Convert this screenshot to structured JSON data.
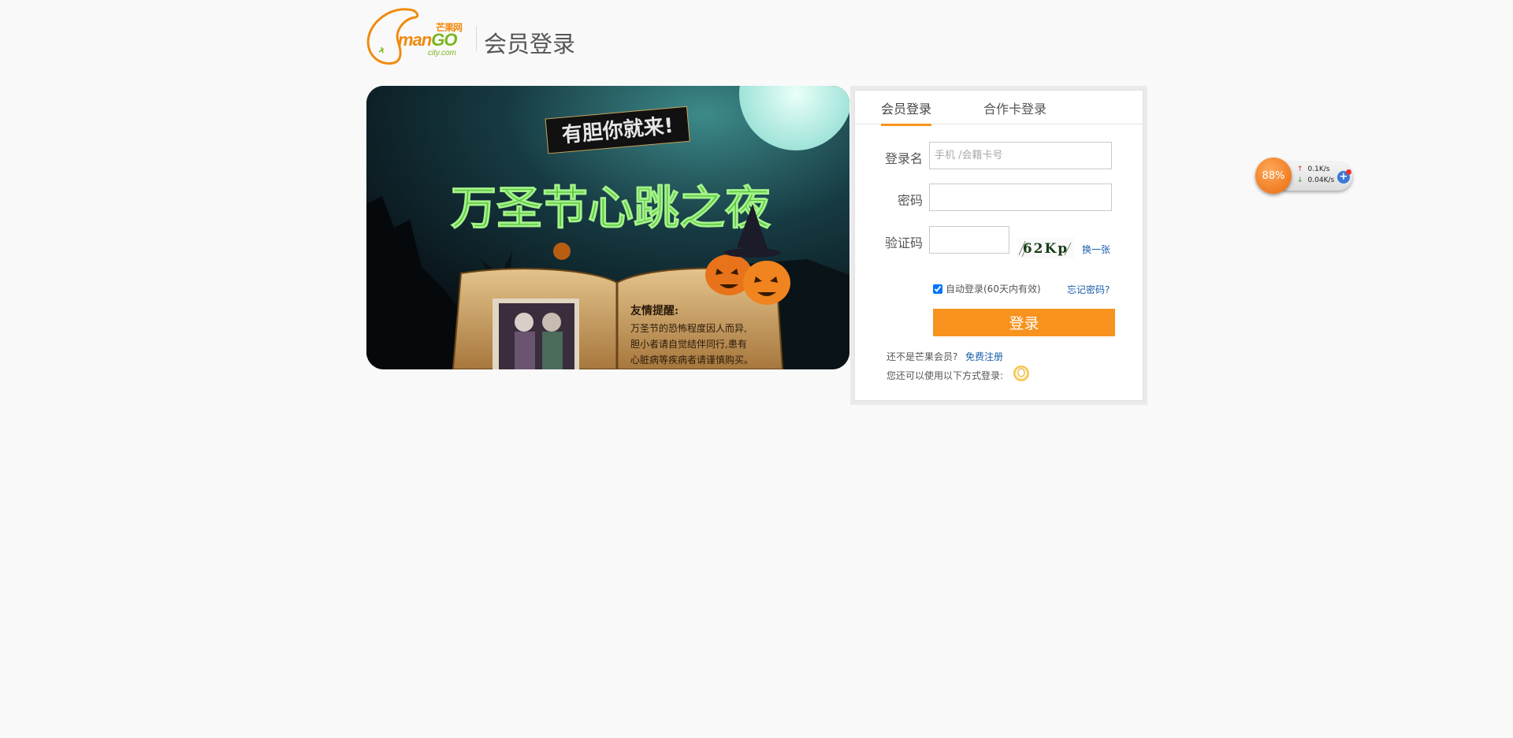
{
  "header": {
    "logo_cn": "芒果网",
    "logo_brand_a": "man",
    "logo_brand_b": "GO",
    "logo_sub": "city.com",
    "title": "会员登录"
  },
  "banner": {
    "tagline": "有胆你就来!",
    "headline": "万圣节心跳之夜",
    "note_title": "友情提醒:",
    "note_line1": "万圣节的恐怖程度因人而异,",
    "note_line2": "胆小者请自觉结伴同行,患有",
    "note_line3": "心脏病等疾病者请谨慎购买。"
  },
  "tabs": [
    {
      "label": "会员登录",
      "active": true
    },
    {
      "label": "合作卡登录",
      "active": false
    }
  ],
  "form": {
    "username_label": "登录名",
    "username_placeholder": "手机 /会籍卡号",
    "username_value": "",
    "password_label": "密码",
    "password_value": "",
    "captcha_label": "验证码",
    "captcha_value": "",
    "captcha_text": "62Kp",
    "refresh_link": "换一张",
    "auto_login_label": "自动登录(60天内有效)",
    "auto_login_checked": true,
    "forgot_link": "忘记密码?",
    "submit_label": "登录",
    "not_member_text": "还不是芒果会员?",
    "register_link": "免费注册",
    "alt_login_text": "您还可以使用以下方式登录:"
  },
  "widget": {
    "percent": "88%",
    "upload": "0.1K/s",
    "download": "0.04K/s"
  },
  "colors": {
    "accent": "#f7931e",
    "link": "#1a5ea8",
    "brand_green": "#7ab51d"
  }
}
